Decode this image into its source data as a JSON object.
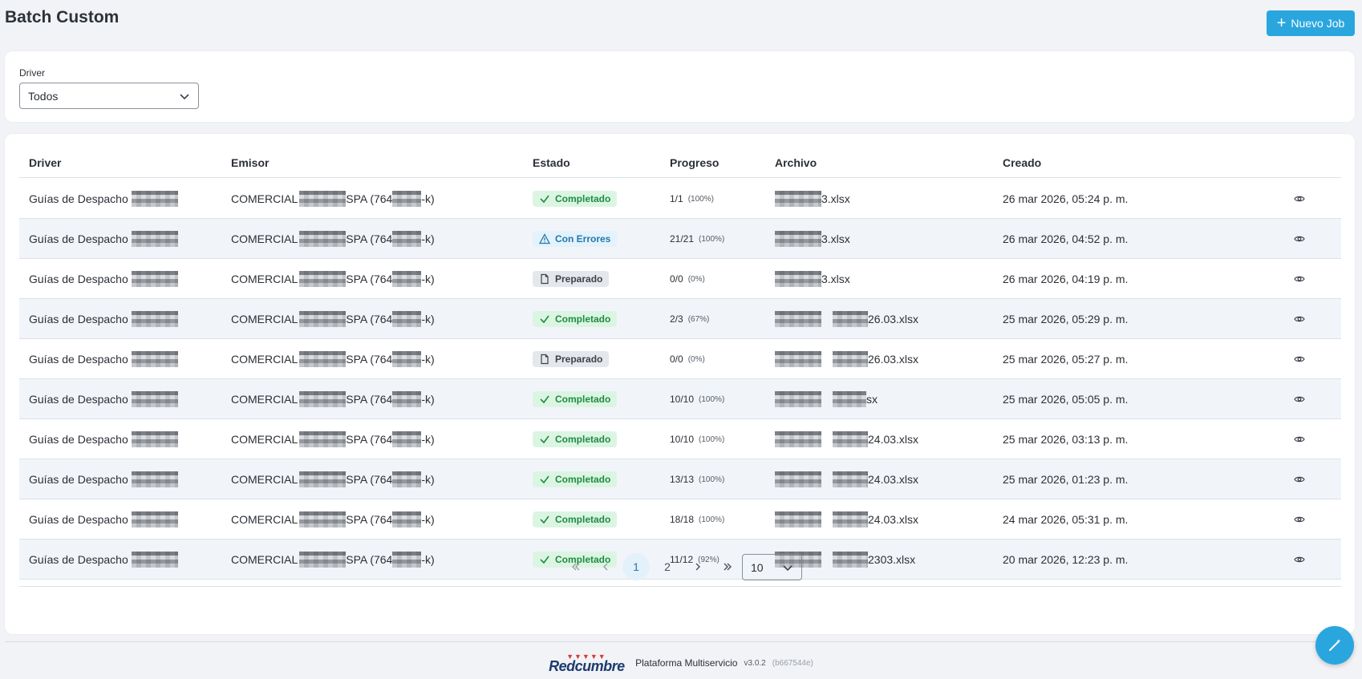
{
  "header": {
    "title": "Batch Custom",
    "new_job_label": "Nuevo Job"
  },
  "filter": {
    "label": "Driver",
    "selected": "Todos"
  },
  "table": {
    "columns": [
      "Driver",
      "Emisor",
      "Estado",
      "Progreso",
      "Archivo",
      "Creado"
    ],
    "rows": [
      {
        "driver": "Guías de Despacho",
        "emisor_a": "COMERCIAL",
        "emisor_b": "SPA (764",
        "emisor_c": "-k)",
        "estado": "Completado",
        "estado_kind": "ok",
        "progreso": "1/1",
        "pct": "(100%)",
        "archivo": "3.xlsx",
        "creado": "26 mar 2026, 05:24 p. m."
      },
      {
        "driver": "Guías de Despacho",
        "emisor_a": "COMERCIAL",
        "emisor_b": "SPA (764",
        "emisor_c": "-k)",
        "estado": "Con Errores",
        "estado_kind": "err",
        "progreso": "21/21",
        "pct": "(100%)",
        "archivo": "3.xlsx",
        "creado": "26 mar 2026, 04:52 p. m."
      },
      {
        "driver": "Guías de Despacho",
        "emisor_a": "COMERCIAL",
        "emisor_b": "SPA (764",
        "emisor_c": "-k)",
        "estado": "Preparado",
        "estado_kind": "prep",
        "progreso": "0/0",
        "pct": "(0%)",
        "archivo": "3.xlsx",
        "creado": "26 mar 2026, 04:19 p. m."
      },
      {
        "driver": "Guías de Despacho",
        "emisor_a": "COMERCIAL",
        "emisor_b": "SPA (764",
        "emisor_c": "-k)",
        "estado": "Completado",
        "estado_kind": "ok",
        "progreso": "2/3",
        "pct": "(67%)",
        "archivo": "26.03.xlsx",
        "creado": "25 mar 2026, 05:29 p. m."
      },
      {
        "driver": "Guías de Despacho",
        "emisor_a": "COMERCIAL",
        "emisor_b": "SPA (764",
        "emisor_c": "-k)",
        "estado": "Preparado",
        "estado_kind": "prep",
        "progreso": "0/0",
        "pct": "(0%)",
        "archivo": "26.03.xlsx",
        "creado": "25 mar 2026, 05:27 p. m."
      },
      {
        "driver": "Guías de Despacho",
        "emisor_a": "COMERCIAL",
        "emisor_b": "SPA (764",
        "emisor_c": "-k)",
        "estado": "Completado",
        "estado_kind": "ok",
        "progreso": "10/10",
        "pct": "(100%)",
        "archivo": "sx",
        "creado": "25 mar 2026, 05:05 p. m."
      },
      {
        "driver": "Guías de Despacho",
        "emisor_a": "COMERCIAL",
        "emisor_b": "SPA (764",
        "emisor_c": "-k)",
        "estado": "Completado",
        "estado_kind": "ok",
        "progreso": "10/10",
        "pct": "(100%)",
        "archivo": "24.03.xlsx",
        "creado": "25 mar 2026, 03:13 p. m."
      },
      {
        "driver": "Guías de Despacho",
        "emisor_a": "COMERCIAL",
        "emisor_b": "SPA (764",
        "emisor_c": "-k)",
        "estado": "Completado",
        "estado_kind": "ok",
        "progreso": "13/13",
        "pct": "(100%)",
        "archivo": "24.03.xlsx",
        "creado": "25 mar 2026, 01:23 p. m."
      },
      {
        "driver": "Guías de Despacho",
        "emisor_a": "COMERCIAL",
        "emisor_b": "SPA (764",
        "emisor_c": "-k)",
        "estado": "Completado",
        "estado_kind": "ok",
        "progreso": "18/18",
        "pct": "(100%)",
        "archivo": "24.03.xlsx",
        "creado": "24 mar 2026, 05:31 p. m."
      },
      {
        "driver": "Guías de Despacho",
        "emisor_a": "COMERCIAL",
        "emisor_b": "SPA (764",
        "emisor_c": "-k)",
        "estado": "Completado",
        "estado_kind": "ok",
        "progreso": "11/12",
        "pct": "(92%)",
        "archivo": "2303.xlsx",
        "creado": "20 mar 2026, 12:23 p. m."
      }
    ]
  },
  "pagination": {
    "pages": [
      "1",
      "2"
    ],
    "current": "1",
    "per_page": "10"
  },
  "footer": {
    "brand": "Redcumbre",
    "name": "Plataforma Multiservicio",
    "version": "v3.0.2",
    "hash": "(b667544e)"
  },
  "colors": {
    "accent": "#2aa6df",
    "ok": "#1f8c43",
    "err": "#2479a8"
  },
  "icons": {
    "new_job": "plus-icon",
    "select": "chevron-down-icon",
    "view": "eye-icon",
    "fab": "magic-wand-icon"
  }
}
